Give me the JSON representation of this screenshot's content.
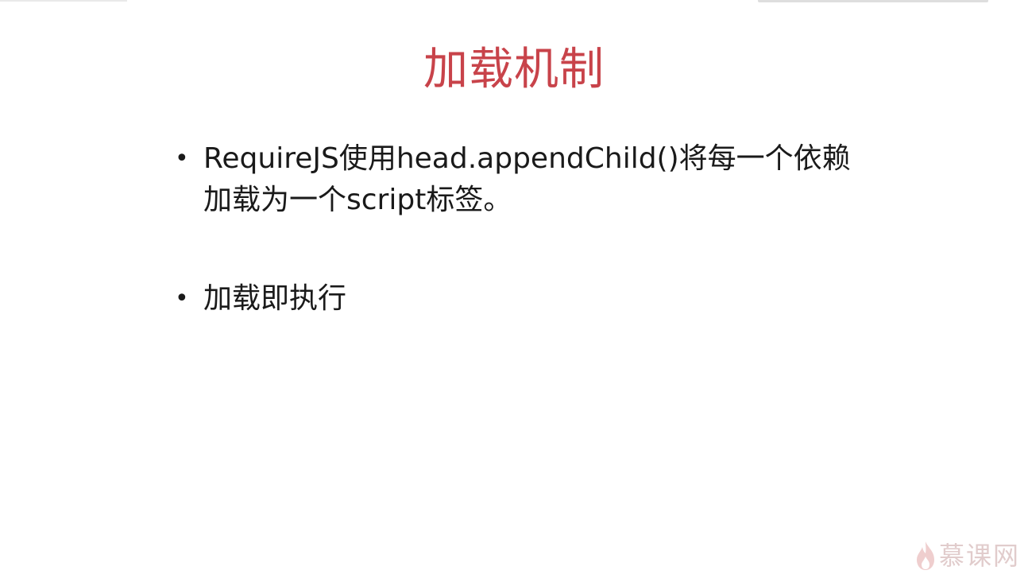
{
  "slide": {
    "title": "加载机制",
    "bullets": [
      {
        "text": "RequireJS使用head.appendChild()将每一个依赖加载为一个script标签。"
      },
      {
        "text": "加载即执行"
      }
    ],
    "bullet_glyph": "•"
  },
  "watermark": {
    "brand_text": "慕课网",
    "icon": "flame-icon"
  },
  "colors": {
    "title": "#c8434a",
    "body_text": "#1a1a1a",
    "background": "#ffffff"
  }
}
